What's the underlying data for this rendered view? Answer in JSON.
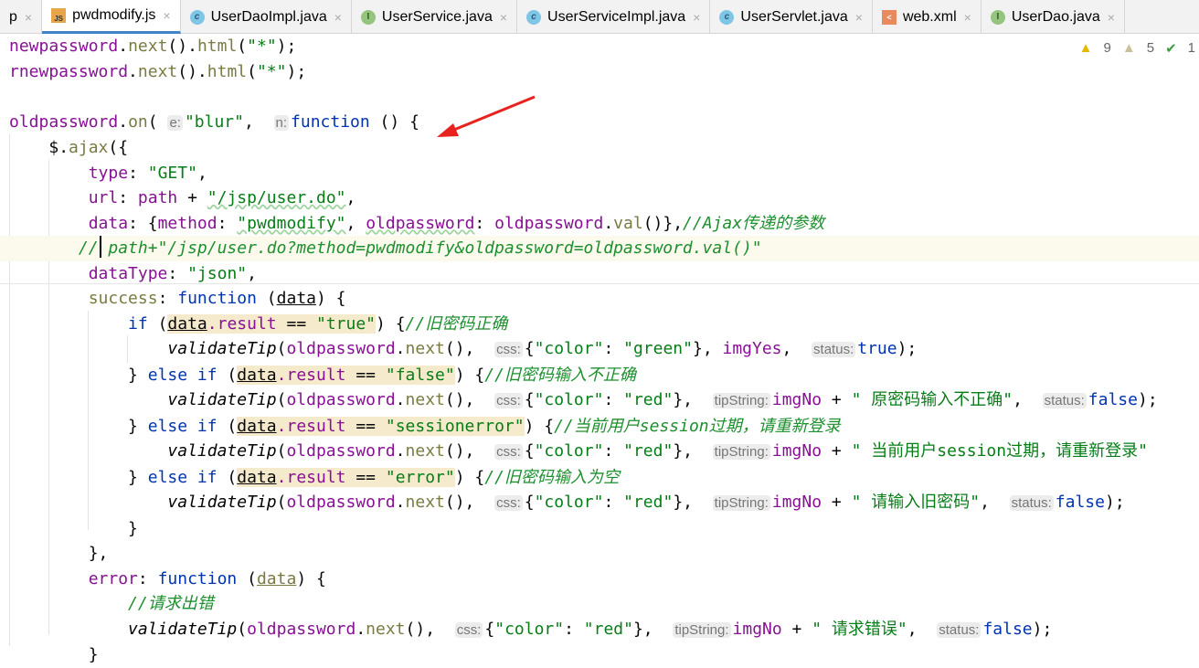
{
  "tabs": [
    {
      "label": "p",
      "icon": "none"
    },
    {
      "label": "pwdmodify.js",
      "icon": "js-file-icon",
      "active": true
    },
    {
      "label": "UserDaoImpl.java",
      "icon": "class-icon"
    },
    {
      "label": "UserService.java",
      "icon": "interface-icon"
    },
    {
      "label": "UserServiceImpl.java",
      "icon": "class-icon"
    },
    {
      "label": "UserServlet.java",
      "icon": "class-icon"
    },
    {
      "label": "web.xml",
      "icon": "xml-file-icon"
    },
    {
      "label": "UserDao.java",
      "icon": "interface-icon"
    }
  ],
  "inspections": {
    "warnings": "9",
    "weak_warnings": "5",
    "ok": "1"
  },
  "code": [
    {
      "indent": 0,
      "tokens": [
        [
          "v",
          "newpassword"
        ],
        [
          "p",
          "."
        ],
        [
          "m",
          "next"
        ],
        [
          "p",
          "()."
        ],
        [
          "m",
          "html"
        ],
        [
          "p",
          "("
        ],
        [
          "s",
          "\"*\""
        ],
        [
          "p",
          ");"
        ]
      ]
    },
    {
      "indent": 0,
      "tokens": [
        [
          "v",
          "rnewpassword"
        ],
        [
          "p",
          "."
        ],
        [
          "m",
          "next"
        ],
        [
          "p",
          "()."
        ],
        [
          "m",
          "html"
        ],
        [
          "p",
          "("
        ],
        [
          "s",
          "\"*\""
        ],
        [
          "p",
          ");"
        ]
      ]
    },
    {
      "indent": 0,
      "tokens": []
    },
    {
      "indent": 0,
      "tokens": [
        [
          "v",
          "oldpassword"
        ],
        [
          "p",
          "."
        ],
        [
          "m",
          "on"
        ],
        [
          "p",
          "( "
        ],
        [
          "h",
          "e:"
        ],
        [
          "s",
          "\"blur\""
        ],
        [
          "p",
          ",  "
        ],
        [
          "h",
          "n:"
        ],
        [
          "k",
          "function"
        ],
        [
          "p",
          " () {"
        ]
      ]
    },
    {
      "indent": 4,
      "tokens": [
        [
          "p",
          "$."
        ],
        [
          "m",
          "ajax"
        ],
        [
          "p",
          "({"
        ]
      ]
    },
    {
      "indent": 8,
      "tokens": [
        [
          "v",
          "type"
        ],
        [
          "p",
          ": "
        ],
        [
          "s",
          "\"GET\""
        ],
        [
          "p",
          ","
        ]
      ]
    },
    {
      "indent": 8,
      "tokens": [
        [
          "v",
          "url"
        ],
        [
          "p",
          ": "
        ],
        [
          "v",
          "path"
        ],
        [
          "p",
          " + "
        ],
        [
          "s u",
          "\"/jsp/user.do\""
        ],
        [
          "p",
          ","
        ]
      ]
    },
    {
      "indent": 8,
      "tokens": [
        [
          "v",
          "data"
        ],
        [
          "p",
          ": {"
        ],
        [
          "v",
          "method"
        ],
        [
          "p",
          ": "
        ],
        [
          "s u",
          "\"pwdmodify\""
        ],
        [
          "p",
          ", "
        ],
        [
          "v u",
          "oldpassword"
        ],
        [
          "p",
          ": "
        ],
        [
          "v",
          "oldpassword"
        ],
        [
          "p",
          "."
        ],
        [
          "m",
          "val"
        ],
        [
          "p",
          "()},"
        ],
        [
          "c",
          "//Ajax传递的参数"
        ]
      ]
    },
    {
      "indent": 7,
      "current": true,
      "tokens": [
        [
          "c",
          "//"
        ],
        [
          "c",
          " path+\"/jsp/user.do?method=pwdmodify&oldpassword=oldpassword.val()\""
        ]
      ]
    },
    {
      "indent": 8,
      "tokens": [
        [
          "v",
          "dataType"
        ],
        [
          "p",
          ": "
        ],
        [
          "s",
          "\"json\""
        ],
        [
          "p",
          ","
        ]
      ]
    },
    {
      "indent": 8,
      "tokens": [
        [
          "m",
          "success"
        ],
        [
          "p",
          ": "
        ],
        [
          "k",
          "function"
        ],
        [
          "p",
          " ("
        ],
        [
          "p d",
          "data"
        ],
        [
          "p",
          ") {"
        ]
      ]
    },
    {
      "indent": 12,
      "tokens": [
        [
          "k",
          "if"
        ],
        [
          "p",
          " ("
        ],
        [
          "p d hl",
          "data"
        ],
        [
          "v hl",
          ".result"
        ],
        [
          "p hl",
          " == "
        ],
        [
          "s hl",
          "\"true\""
        ],
        [
          "p",
          ") {"
        ],
        [
          "c",
          "//旧密码正确"
        ]
      ]
    },
    {
      "indent": 16,
      "tokens": [
        [
          "f",
          "validateTip"
        ],
        [
          "p",
          "("
        ],
        [
          "v",
          "oldpassword"
        ],
        [
          "p",
          "."
        ],
        [
          "m",
          "next"
        ],
        [
          "p",
          "(),  "
        ],
        [
          "h",
          "css:"
        ],
        [
          "p",
          "{"
        ],
        [
          "s",
          "\"color\""
        ],
        [
          "p",
          ": "
        ],
        [
          "s",
          "\"green\""
        ],
        [
          "p",
          "}, "
        ],
        [
          "v",
          "imgYes"
        ],
        [
          "p",
          ",  "
        ],
        [
          "h",
          "status:"
        ],
        [
          "k",
          "true"
        ],
        [
          "p",
          ");"
        ]
      ]
    },
    {
      "indent": 12,
      "tokens": [
        [
          "p",
          "} "
        ],
        [
          "k",
          "else if"
        ],
        [
          "p",
          " ("
        ],
        [
          "p d hl",
          "data"
        ],
        [
          "v hl",
          ".result"
        ],
        [
          "p hl",
          " == "
        ],
        [
          "s hl",
          "\"false\""
        ],
        [
          "p",
          ") {"
        ],
        [
          "c",
          "//旧密码输入不正确"
        ]
      ]
    },
    {
      "indent": 16,
      "tokens": [
        [
          "f",
          "validateTip"
        ],
        [
          "p",
          "("
        ],
        [
          "v",
          "oldpassword"
        ],
        [
          "p",
          "."
        ],
        [
          "m",
          "next"
        ],
        [
          "p",
          "(),  "
        ],
        [
          "h",
          "css:"
        ],
        [
          "p",
          "{"
        ],
        [
          "s",
          "\"color\""
        ],
        [
          "p",
          ": "
        ],
        [
          "s",
          "\"red\""
        ],
        [
          "p",
          "},  "
        ],
        [
          "h",
          "tipString:"
        ],
        [
          "v",
          "imgNo"
        ],
        [
          "p",
          " + "
        ],
        [
          "s",
          "\" 原密码输入不正确\""
        ],
        [
          "p",
          ",  "
        ],
        [
          "h",
          "status:"
        ],
        [
          "k",
          "false"
        ],
        [
          "p",
          ");"
        ]
      ]
    },
    {
      "indent": 12,
      "tokens": [
        [
          "p",
          "} "
        ],
        [
          "k",
          "else if"
        ],
        [
          "p",
          " ("
        ],
        [
          "p d hl",
          "data"
        ],
        [
          "v hl",
          ".result"
        ],
        [
          "p hl",
          " == "
        ],
        [
          "s hl",
          "\"sessionerror\""
        ],
        [
          "p",
          ") {"
        ],
        [
          "c",
          "//当前用户session过期，请重新登录"
        ]
      ]
    },
    {
      "indent": 16,
      "tokens": [
        [
          "f",
          "validateTip"
        ],
        [
          "p",
          "("
        ],
        [
          "v",
          "oldpassword"
        ],
        [
          "p",
          "."
        ],
        [
          "m",
          "next"
        ],
        [
          "p",
          "(),  "
        ],
        [
          "h",
          "css:"
        ],
        [
          "p",
          "{"
        ],
        [
          "s",
          "\"color\""
        ],
        [
          "p",
          ": "
        ],
        [
          "s",
          "\"red\""
        ],
        [
          "p",
          "},  "
        ],
        [
          "h",
          "tipString:"
        ],
        [
          "v",
          "imgNo"
        ],
        [
          "p",
          " + "
        ],
        [
          "s",
          "\" 当前用户session过期，请重新登录\""
        ]
      ]
    },
    {
      "indent": 12,
      "tokens": [
        [
          "p",
          "} "
        ],
        [
          "k",
          "else if"
        ],
        [
          "p",
          " ("
        ],
        [
          "p d hl",
          "data"
        ],
        [
          "v hl",
          ".result"
        ],
        [
          "p hl",
          " == "
        ],
        [
          "s hl",
          "\"error\""
        ],
        [
          "p",
          ") {"
        ],
        [
          "c",
          "//旧密码输入为空"
        ]
      ]
    },
    {
      "indent": 16,
      "tokens": [
        [
          "f",
          "validateTip"
        ],
        [
          "p",
          "("
        ],
        [
          "v",
          "oldpassword"
        ],
        [
          "p",
          "."
        ],
        [
          "m",
          "next"
        ],
        [
          "p",
          "(),  "
        ],
        [
          "h",
          "css:"
        ],
        [
          "p",
          "{"
        ],
        [
          "s",
          "\"color\""
        ],
        [
          "p",
          ": "
        ],
        [
          "s",
          "\"red\""
        ],
        [
          "p",
          "},  "
        ],
        [
          "h",
          "tipString:"
        ],
        [
          "v",
          "imgNo"
        ],
        [
          "p",
          " + "
        ],
        [
          "s",
          "\" 请输入旧密码\""
        ],
        [
          "p",
          ",  "
        ],
        [
          "h",
          "status:"
        ],
        [
          "k",
          "false"
        ],
        [
          "p",
          ");"
        ]
      ]
    },
    {
      "indent": 12,
      "tokens": [
        [
          "p",
          "}"
        ]
      ]
    },
    {
      "indent": 8,
      "tokens": [
        [
          "p",
          "},"
        ]
      ]
    },
    {
      "indent": 8,
      "tokens": [
        [
          "v",
          "error"
        ],
        [
          "p",
          ": "
        ],
        [
          "k",
          "function"
        ],
        [
          "p",
          " ("
        ],
        [
          "m d",
          "data"
        ],
        [
          "p",
          ") {"
        ]
      ]
    },
    {
      "indent": 12,
      "tokens": [
        [
          "c",
          "//请求出错"
        ]
      ]
    },
    {
      "indent": 12,
      "tokens": [
        [
          "f",
          "validateTip"
        ],
        [
          "p",
          "("
        ],
        [
          "v",
          "oldpassword"
        ],
        [
          "p",
          "."
        ],
        [
          "m",
          "next"
        ],
        [
          "p",
          "(),  "
        ],
        [
          "h",
          "css:"
        ],
        [
          "p",
          "{"
        ],
        [
          "s",
          "\"color\""
        ],
        [
          "p",
          ": "
        ],
        [
          "s",
          "\"red\""
        ],
        [
          "p",
          "},  "
        ],
        [
          "h",
          "tipString:"
        ],
        [
          "v",
          "imgNo"
        ],
        [
          "p",
          " + "
        ],
        [
          "s",
          "\" 请求错误\""
        ],
        [
          "p",
          ",  "
        ],
        [
          "h",
          "status:"
        ],
        [
          "k",
          "false"
        ],
        [
          "p",
          ");"
        ]
      ]
    },
    {
      "indent": 8,
      "tokens": [
        [
          "p",
          "}"
        ]
      ]
    }
  ],
  "colors": {
    "accent": "#4083c9",
    "annotation_arrow": "#e8231f"
  }
}
